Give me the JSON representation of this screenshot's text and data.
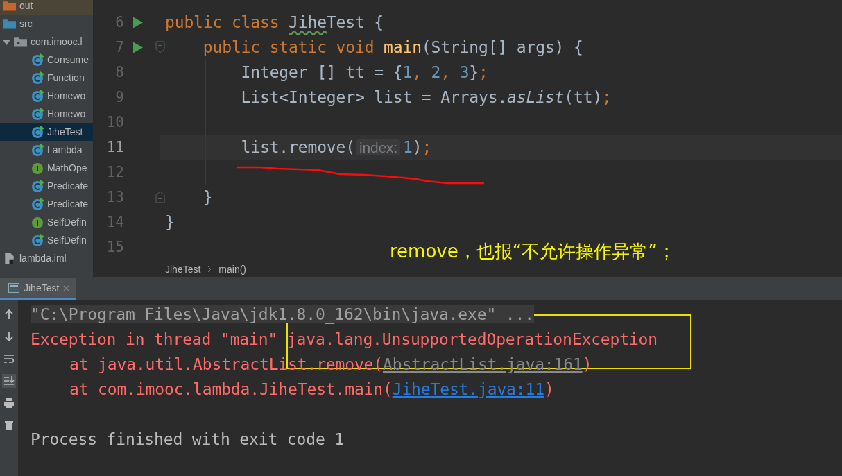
{
  "sidebar": {
    "items": [
      {
        "label": "out",
        "kind": "folder-excluded"
      },
      {
        "label": "src",
        "kind": "folder-source"
      },
      {
        "label": "com.imooc.l",
        "kind": "package",
        "expanded": true,
        "children": [
          {
            "label": "Consume",
            "kind": "class",
            "selected": false
          },
          {
            "label": "Function",
            "kind": "class",
            "selected": false
          },
          {
            "label": "Homewo",
            "kind": "class",
            "selected": false
          },
          {
            "label": "Homewo",
            "kind": "class",
            "selected": false
          },
          {
            "label": "JiheTest",
            "kind": "class",
            "selected": true
          },
          {
            "label": "Lambda",
            "kind": "class",
            "selected": false
          },
          {
            "label": "MathOpe",
            "kind": "interface",
            "selected": false
          },
          {
            "label": "Predicate",
            "kind": "class",
            "selected": false
          },
          {
            "label": "Predicate",
            "kind": "class",
            "selected": false
          },
          {
            "label": "SelfDefin",
            "kind": "interface",
            "selected": false
          },
          {
            "label": "SelfDefin",
            "kind": "class",
            "selected": false
          }
        ]
      },
      {
        "label": "lambda.iml",
        "kind": "module-file"
      }
    ]
  },
  "editor": {
    "lines": [
      {
        "number": "6",
        "run": true,
        "fold_start": false,
        "fold_end": false,
        "current": false,
        "segments": [
          {
            "text": "public class ",
            "kind": "keyword"
          },
          {
            "text": "Jihe",
            "kind": "typo"
          },
          {
            "text": "Test {",
            "kind": "plain"
          }
        ]
      },
      {
        "number": "7",
        "run": true,
        "fold_start": true,
        "fold_end": false,
        "current": false,
        "segments": [
          {
            "text": "    public static void ",
            "kind": "keyword"
          },
          {
            "text": "main",
            "kind": "method"
          },
          {
            "text": "(String[] args) {",
            "kind": "plain"
          }
        ]
      },
      {
        "number": "8",
        "run": false,
        "fold_start": false,
        "fold_end": false,
        "current": false,
        "segments": [
          {
            "text": "        Integer [] tt = {",
            "kind": "plain"
          },
          {
            "text": "1",
            "kind": "number"
          },
          {
            "text": ", ",
            "kind": "keyword"
          },
          {
            "text": "2",
            "kind": "number"
          },
          {
            "text": ", ",
            "kind": "keyword"
          },
          {
            "text": "3",
            "kind": "number"
          },
          {
            "text": "}",
            "kind": "plain"
          },
          {
            "text": ";",
            "kind": "keyword"
          }
        ]
      },
      {
        "number": "9",
        "run": false,
        "fold_start": false,
        "fold_end": false,
        "current": false,
        "segments": [
          {
            "text": "        List<Integer> list = Arrays.",
            "kind": "plain"
          },
          {
            "text": "asList",
            "kind": "static"
          },
          {
            "text": "(tt)",
            "kind": "plain"
          },
          {
            "text": ";",
            "kind": "keyword"
          }
        ]
      },
      {
        "number": "10",
        "run": false,
        "fold_start": false,
        "fold_end": false,
        "current": false
      },
      {
        "number": "11",
        "run": false,
        "fold_start": false,
        "fold_end": false,
        "current": true,
        "segments": [
          {
            "text": "        list.remove(",
            "kind": "plain"
          },
          {
            "text": "index:",
            "kind": "hint"
          },
          {
            "text": "1",
            "kind": "number"
          },
          {
            "text": ")",
            "kind": "plain"
          },
          {
            "text": ";",
            "kind": "keyword"
          }
        ]
      },
      {
        "number": "12",
        "run": false,
        "fold_start": false,
        "fold_end": false,
        "current": false
      },
      {
        "number": "13",
        "run": false,
        "fold_start": false,
        "fold_end": true,
        "current": false,
        "segments": [
          {
            "text": "    }",
            "kind": "plain"
          }
        ]
      },
      {
        "number": "14",
        "run": false,
        "fold_start": false,
        "fold_end": false,
        "current": false,
        "segments": [
          {
            "text": "}",
            "kind": "plain"
          }
        ]
      },
      {
        "number": "15",
        "run": false,
        "fold_start": false,
        "fold_end": false,
        "current": false
      }
    ]
  },
  "breadcrumb": [
    "JiheTest",
    "main()"
  ],
  "annotation": {
    "note": "remove，也报“不允许操作异常”；"
  },
  "console": {
    "tab": {
      "label": "JiheTest",
      "selected": true
    },
    "lines": [
      {
        "indented": false,
        "gap_before": false,
        "segments": [
          {
            "text": "\"C:\\Program Files\\Java\\jdk1.8.0_162\\bin\\java.exe\" ...",
            "kind": "command"
          }
        ]
      },
      {
        "indented": false,
        "gap_before": false,
        "segments": [
          {
            "text": "Exception in thread \"main\" java.lang.UnsupportedOperationException",
            "kind": "error"
          }
        ]
      },
      {
        "indented": true,
        "gap_before": false,
        "segments": [
          {
            "text": "at java.util.AbstractList.remove(",
            "kind": "error"
          },
          {
            "text": "AbstractList.java:161",
            "kind": "library-link"
          },
          {
            "text": ")",
            "kind": "error"
          }
        ]
      },
      {
        "indented": true,
        "gap_before": false,
        "segments": [
          {
            "text": "at com.imooc.lambda.JiheTest.main(",
            "kind": "error"
          },
          {
            "text": "JiheTest.java:11",
            "kind": "link"
          },
          {
            "text": ")",
            "kind": "error"
          }
        ]
      },
      {
        "indented": false,
        "gap_before": true,
        "segments": [
          {
            "text": "Process finished with exit code 1",
            "kind": "normal"
          }
        ]
      }
    ]
  }
}
